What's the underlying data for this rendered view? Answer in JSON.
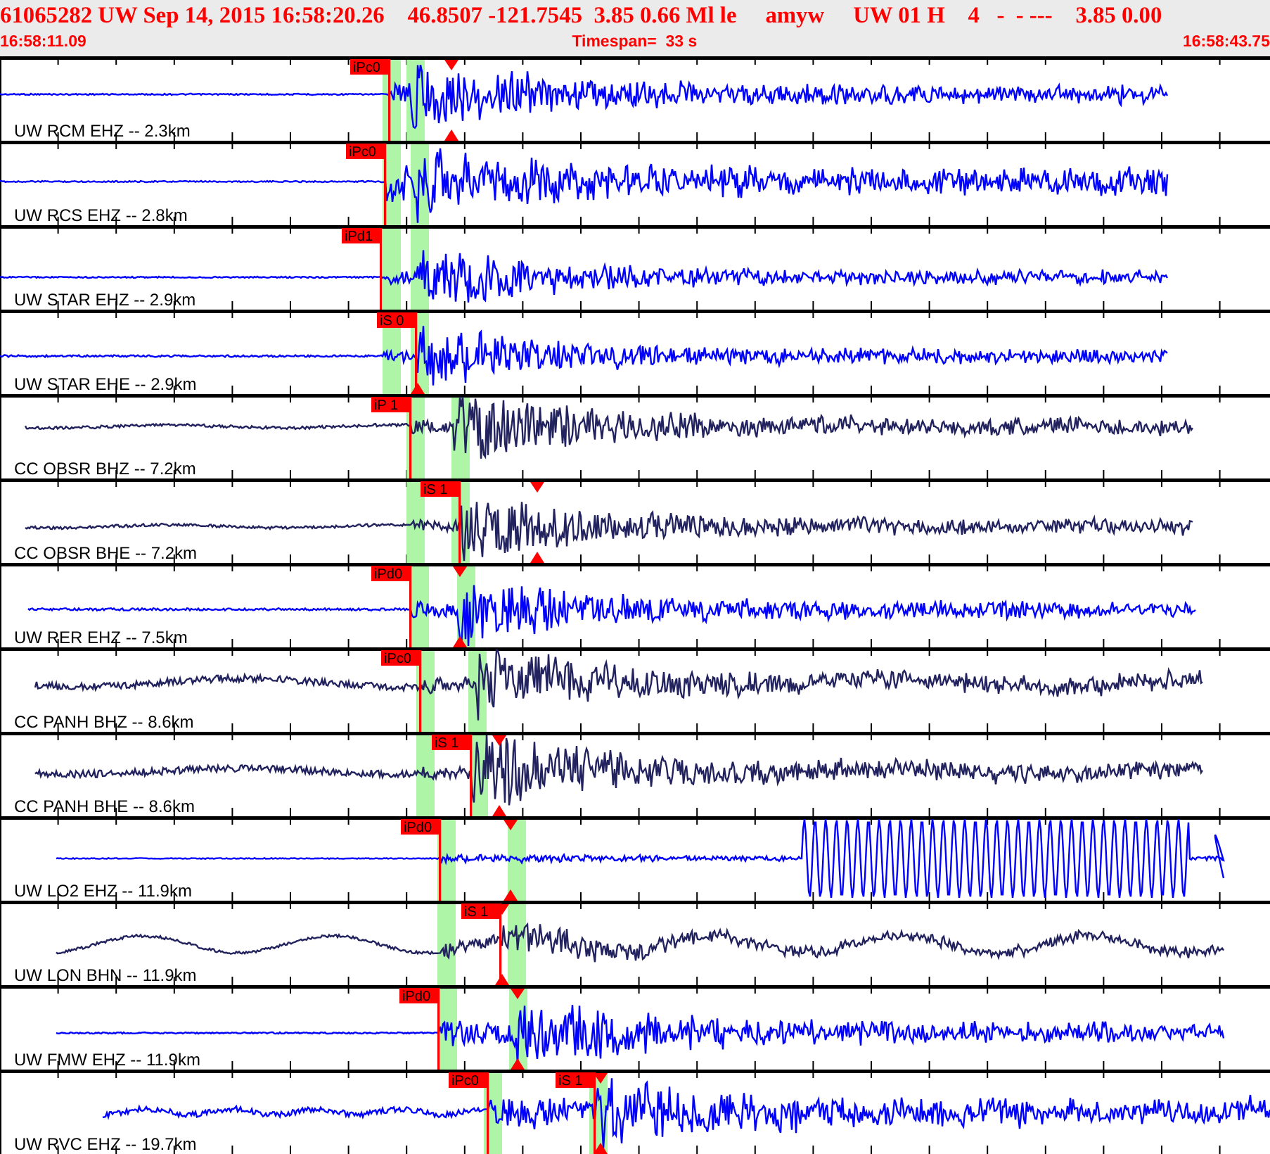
{
  "header": {
    "summary": "61065282 UW Sep 14, 2015 16:58:20.26    46.8507 -121.7545  3.85 0.66 Ml le     amyw     UW 01 H    4   -  - ---    3.85 0.00",
    "start_time": "16:58:11.09",
    "timespan": "Timespan=  33 s",
    "end_time": "16:58:43.75"
  },
  "traces": [
    {
      "label": "UW RCM EHZ -- 2.3km",
      "color": "#0000ff",
      "picks": [
        "iPc0"
      ]
    },
    {
      "label": "UW RCS EHZ -- 2.8km",
      "color": "#0000ff",
      "picks": [
        "iPc0"
      ]
    },
    {
      "label": "UW STAR EHZ -- 2.9km",
      "color": "#0000ff",
      "picks": [
        "iPd1"
      ]
    },
    {
      "label": "UW STAR EHE -- 2.9km",
      "color": "#0000ff",
      "picks": [
        "iS 0"
      ]
    },
    {
      "label": "CC OBSR BHZ -- 7.2km",
      "color": "#22225e",
      "picks": [
        "iP 1"
      ]
    },
    {
      "label": "CC OBSR BHE -- 7.2km",
      "color": "#22225e",
      "picks": [
        "iS 1"
      ]
    },
    {
      "label": "UW RER EHZ -- 7.5km",
      "color": "#0000ff",
      "picks": [
        "iPd0"
      ]
    },
    {
      "label": "CC PANH BHZ -- 8.6km",
      "color": "#22225e",
      "picks": [
        "iPc0"
      ]
    },
    {
      "label": "CC PANH BHE -- 8.6km",
      "color": "#22225e",
      "picks": [
        "iS 1"
      ]
    },
    {
      "label": "UW LO2 EHZ -- 11.9km",
      "color": "#0000ff",
      "picks": [
        "iPd0"
      ]
    },
    {
      "label": "UW LON BHN -- 11.9km",
      "color": "#22225e",
      "picks": [
        "iS 1"
      ]
    },
    {
      "label": "UW FMW EHZ -- 11.9km",
      "color": "#0000ff",
      "picks": [
        "iPd0"
      ]
    },
    {
      "label": "UW RVC EHZ -- 19.7km",
      "color": "#0000ff",
      "picks": [
        "iPc0",
        "iS 1"
      ]
    }
  ]
}
